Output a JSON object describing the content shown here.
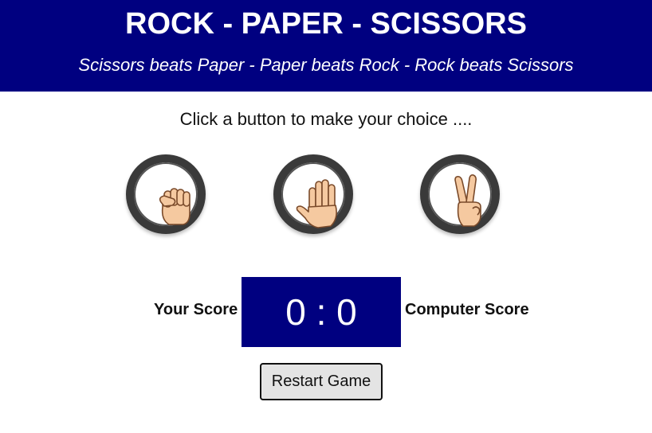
{
  "header": {
    "title": "ROCK - PAPER - SCISSORS",
    "subtitle": "Scissors beats Paper - Paper beats Rock - Rock beats Scissors"
  },
  "instruction": "Click a button to make your choice ....",
  "choices": [
    {
      "name": "rock",
      "icon": "raised-fist-icon"
    },
    {
      "name": "paper",
      "icon": "raised-hand-icon"
    },
    {
      "name": "scissors",
      "icon": "victory-hand-icon"
    }
  ],
  "score": {
    "player_label": "Your Score",
    "computer_label": "Computer Score",
    "player": 0,
    "computer": 0,
    "display": "0 : 0"
  },
  "restart_label": "Restart Game",
  "colors": {
    "brand": "#000080",
    "skin": "#F5C9A0",
    "ring": "#3A3A3A"
  }
}
